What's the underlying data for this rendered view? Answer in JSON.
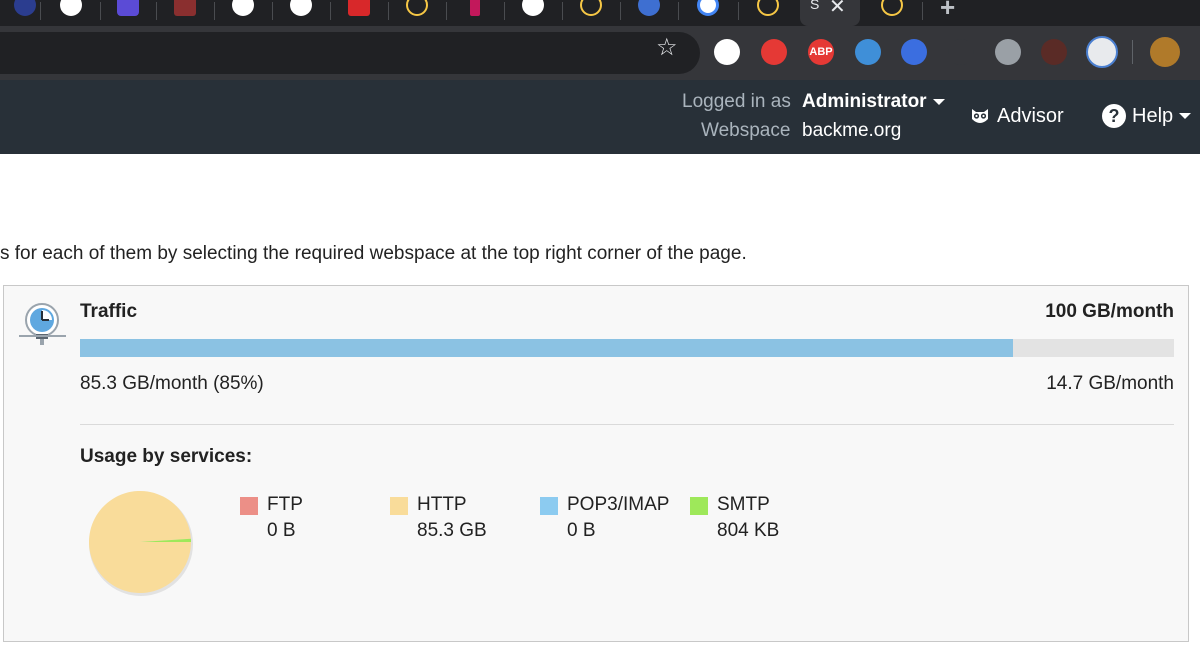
{
  "browser": {
    "active_tab_label": "S",
    "active_tab_close": "✕",
    "new_tab": "+",
    "bookmark_icon": "star-icon",
    "extensions": [
      {
        "name": "translate-icon",
        "label": "",
        "color": "#ffffff"
      },
      {
        "name": "adblock-hand-icon",
        "label": "",
        "color": "#e53935"
      },
      {
        "name": "abp-icon",
        "label": "ABP",
        "color": "#e53935"
      },
      {
        "name": "ghostery-icon",
        "label": "",
        "color": "#3f8fd8"
      },
      {
        "name": "bookmark-ext-icon",
        "label": "",
        "color": "#3b6ee0"
      },
      {
        "name": "paw-icon",
        "label": "",
        "color": "#35363a"
      },
      {
        "name": "key-icon",
        "label": "",
        "color": "#9aa0a6"
      },
      {
        "name": "pdf-icon",
        "label": "",
        "color": "#5a2b26"
      },
      {
        "name": "window-ext-icon",
        "label": "",
        "color": "#e8eaed"
      },
      {
        "name": "profile-avatar",
        "label": "",
        "color": "#b07a2a"
      }
    ]
  },
  "header": {
    "logged_in_label": "Logged in as",
    "user": "Administrator",
    "webspace_label": "Webspace",
    "webspace": "backme.org",
    "advisor": "Advisor",
    "help": "Help",
    "help_icon_glyph": "?"
  },
  "intro_text": "s for each of them by selecting the required webspace at the top right corner of the page.",
  "traffic": {
    "title": "Traffic",
    "limit": "100 GB/month",
    "used": "85.3 GB/month (85%)",
    "free": "14.7 GB/month",
    "used_fraction": 0.853,
    "bar_color": "#8bc2e3"
  },
  "usage": {
    "title": "Usage by services:",
    "services": [
      {
        "name": "FTP",
        "value": "0 B",
        "color": "#ec8f87",
        "share": 0
      },
      {
        "name": "HTTP",
        "value": "85.3 GB",
        "color": "#f9dc9a",
        "share": 0.99
      },
      {
        "name": "POP3/IMAP",
        "value": "0 B",
        "color": "#8ccbf0",
        "share": 0
      },
      {
        "name": "SMTP",
        "value": "804 KB",
        "color": "#9ee85a",
        "share": 0.01
      }
    ]
  }
}
